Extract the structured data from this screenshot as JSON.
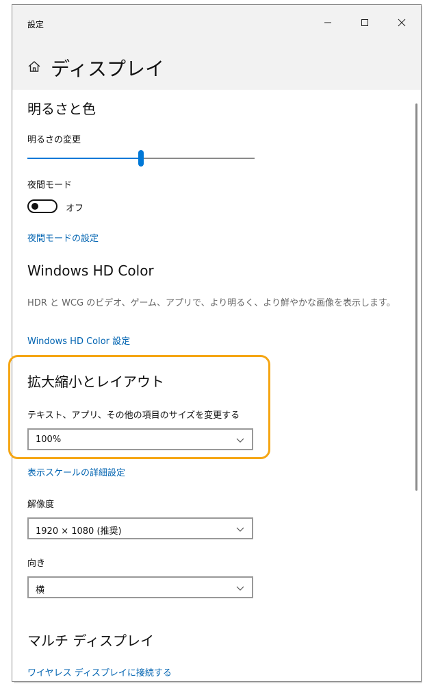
{
  "window": {
    "title": "設定"
  },
  "header": {
    "title": "ディスプレイ",
    "home_icon": "home-icon"
  },
  "brightness": {
    "title": "明るさと色",
    "change_label": "明るさの変更",
    "level": 0.5,
    "night_mode_label": "夜間モード",
    "night_mode_state": "オフ",
    "night_mode_settings_link": "夜間モードの設定"
  },
  "hd_color": {
    "title": "Windows HD Color",
    "description": "HDR と WCG のビデオ、ゲーム、アプリで、より明るく、より鮮やかな画像を表示します。",
    "settings_link": "Windows HD Color 設定"
  },
  "scale": {
    "title": "拡大縮小とレイアウト",
    "size_label": "テキスト、アプリ、その他の項目のサイズを変更する",
    "size_value": "100%",
    "advanced_link": "表示スケールの詳細設定",
    "resolution_label": "解像度",
    "resolution_value": "1920 × 1080 (推奨)",
    "orientation_label": "向き",
    "orientation_value": "横"
  },
  "multi_display": {
    "title": "マルチ ディスプレイ",
    "wireless_link": "ワイヤレス ディスプレイに接続する"
  },
  "colors": {
    "accent": "#0078d7",
    "link": "#0063b1",
    "highlight": "#f5a614"
  }
}
